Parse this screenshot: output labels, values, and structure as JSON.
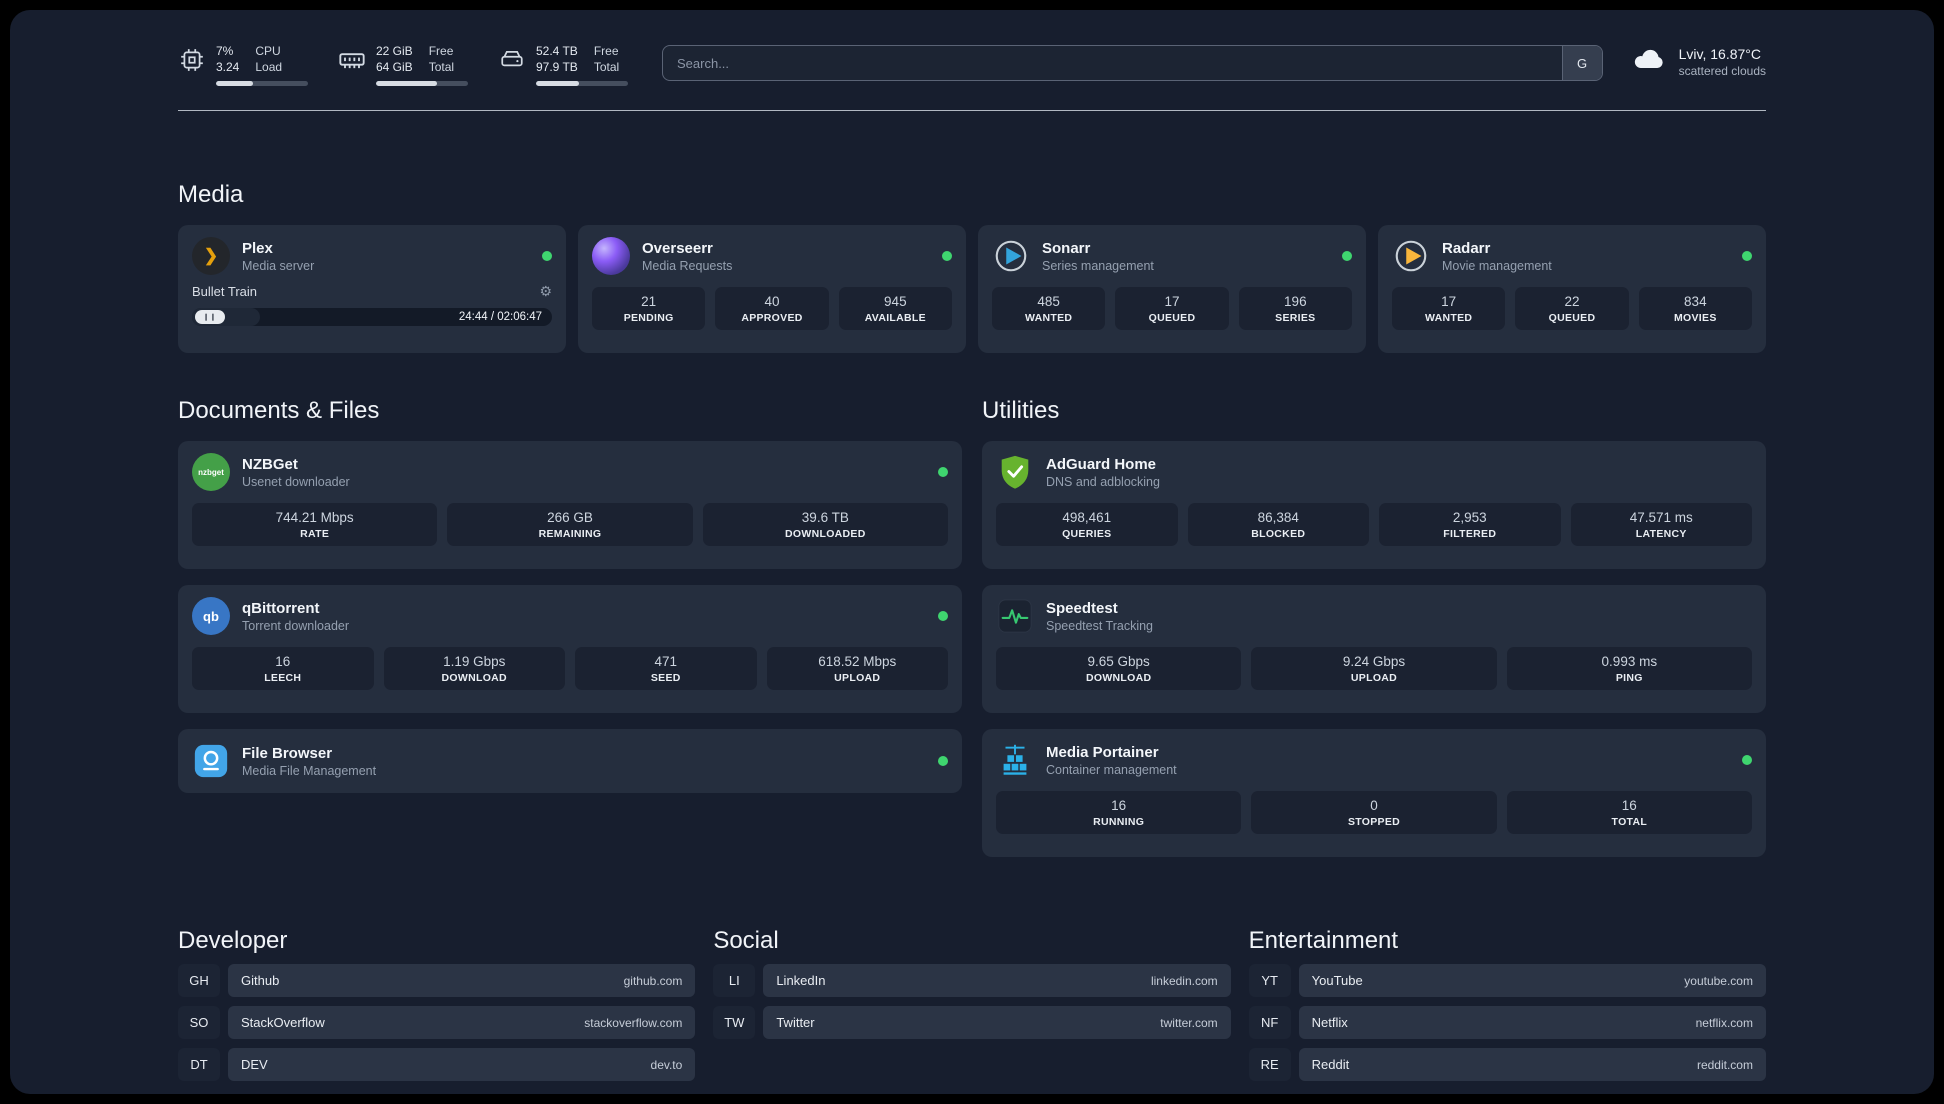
{
  "topbar": {
    "cpu": {
      "value_top": "7%",
      "value_bottom": "3.24",
      "label_top": "CPU",
      "label_bottom": "Load",
      "bar_percent": 40
    },
    "ram": {
      "value_top": "22 GiB",
      "value_bottom": "64 GiB",
      "label_top": "Free",
      "label_bottom": "Total",
      "bar_percent": 66
    },
    "disk": {
      "value_top": "52.4 TB",
      "value_bottom": "97.9 TB",
      "label_top": "Free",
      "label_bottom": "Total",
      "bar_percent": 47
    },
    "search": {
      "placeholder": "Search...",
      "engine_button": "G"
    },
    "weather": {
      "location": "Lviv, 16.87°C",
      "condition": "scattered clouds"
    }
  },
  "status": {
    "online_color": "#3fd56f"
  },
  "sections": {
    "media": {
      "heading": "Media",
      "plex": {
        "title": "Plex",
        "subtitle": "Media server",
        "now_playing": "Bullet Train",
        "time": "24:44 / 02:06:47",
        "progress_percent": 19
      },
      "overseerr": {
        "title": "Overseerr",
        "subtitle": "Media Requests",
        "stats": [
          {
            "value": "21",
            "label": "PENDING"
          },
          {
            "value": "40",
            "label": "APPROVED"
          },
          {
            "value": "945",
            "label": "AVAILABLE"
          }
        ]
      },
      "sonarr": {
        "title": "Sonarr",
        "subtitle": "Series management",
        "stats": [
          {
            "value": "485",
            "label": "WANTED"
          },
          {
            "value": "17",
            "label": "QUEUED"
          },
          {
            "value": "196",
            "label": "SERIES"
          }
        ]
      },
      "radarr": {
        "title": "Radarr",
        "subtitle": "Movie management",
        "stats": [
          {
            "value": "17",
            "label": "WANTED"
          },
          {
            "value": "22",
            "label": "QUEUED"
          },
          {
            "value": "834",
            "label": "MOVIES"
          }
        ]
      }
    },
    "documents": {
      "heading": "Documents & Files",
      "nzbget": {
        "title": "NZBGet",
        "subtitle": "Usenet downloader",
        "badge": "nzbget",
        "stats": [
          {
            "value": "744.21 Mbps",
            "label": "RATE"
          },
          {
            "value": "266 GB",
            "label": "REMAINING"
          },
          {
            "value": "39.6 TB",
            "label": "DOWNLOADED"
          }
        ]
      },
      "qbittorrent": {
        "title": "qBittorrent",
        "subtitle": "Torrent downloader",
        "badge": "qb",
        "stats": [
          {
            "value": "16",
            "label": "LEECH"
          },
          {
            "value": "1.19 Gbps",
            "label": "DOWNLOAD"
          },
          {
            "value": "471",
            "label": "SEED"
          },
          {
            "value": "618.52 Mbps",
            "label": "UPLOAD"
          }
        ]
      },
      "filebrowser": {
        "title": "File Browser",
        "subtitle": "Media File Management"
      }
    },
    "utilities": {
      "heading": "Utilities",
      "adguard": {
        "title": "AdGuard Home",
        "subtitle": "DNS and adblocking",
        "stats": [
          {
            "value": "498,461",
            "label": "QUERIES"
          },
          {
            "value": "86,384",
            "label": "BLOCKED"
          },
          {
            "value": "2,953",
            "label": "FILTERED"
          },
          {
            "value": "47.571 ms",
            "label": "LATENCY"
          }
        ]
      },
      "speedtest": {
        "title": "Speedtest",
        "subtitle": "Speedtest Tracking",
        "stats": [
          {
            "value": "9.65 Gbps",
            "label": "DOWNLOAD"
          },
          {
            "value": "9.24 Gbps",
            "label": "UPLOAD"
          },
          {
            "value": "0.993 ms",
            "label": "PING"
          }
        ]
      },
      "portainer": {
        "title": "Media Portainer",
        "subtitle": "Container management",
        "stats": [
          {
            "value": "16",
            "label": "RUNNING"
          },
          {
            "value": "0",
            "label": "STOPPED"
          },
          {
            "value": "16",
            "label": "TOTAL"
          }
        ]
      }
    },
    "bookmarks": {
      "developer": {
        "heading": "Developer",
        "items": [
          {
            "abbr": "GH",
            "name": "Github",
            "url": "github.com"
          },
          {
            "abbr": "SO",
            "name": "StackOverflow",
            "url": "stackoverflow.com"
          },
          {
            "abbr": "DT",
            "name": "DEV",
            "url": "dev.to"
          }
        ]
      },
      "social": {
        "heading": "Social",
        "items": [
          {
            "abbr": "LI",
            "name": "LinkedIn",
            "url": "linkedin.com"
          },
          {
            "abbr": "TW",
            "name": "Twitter",
            "url": "twitter.com"
          }
        ]
      },
      "entertainment": {
        "heading": "Entertainment",
        "items": [
          {
            "abbr": "YT",
            "name": "YouTube",
            "url": "youtube.com"
          },
          {
            "abbr": "NF",
            "name": "Netflix",
            "url": "netflix.com"
          },
          {
            "abbr": "RE",
            "name": "Reddit",
            "url": "reddit.com"
          }
        ]
      }
    }
  }
}
